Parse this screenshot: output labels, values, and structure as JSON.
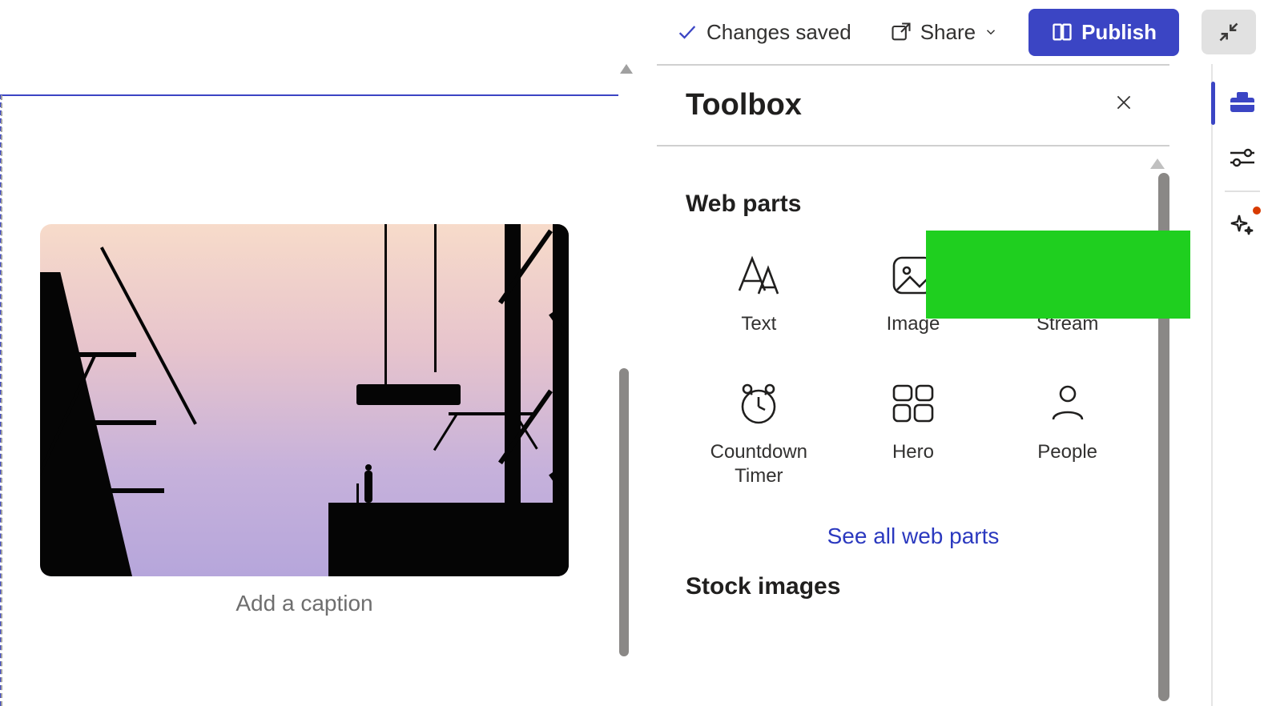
{
  "commandBar": {
    "savedStatus": "Changes saved",
    "shareLabel": "Share",
    "publishLabel": "Publish"
  },
  "canvas": {
    "captionPlaceholder": "Add a caption"
  },
  "toolbox": {
    "title": "Toolbox",
    "sections": {
      "webParts": {
        "title": "Web parts",
        "items": [
          {
            "label": "Text",
            "icon": "text-icon"
          },
          {
            "label": "Image",
            "icon": "image-icon"
          },
          {
            "label": "Stream",
            "icon": "stream-icon"
          },
          {
            "label": "Countdown Timer",
            "icon": "countdown-timer-icon"
          },
          {
            "label": "Hero",
            "icon": "hero-icon"
          },
          {
            "label": "People",
            "icon": "people-icon"
          }
        ],
        "seeAll": "See all web parts"
      },
      "stockImages": {
        "title": "Stock images"
      }
    }
  },
  "rightRail": {
    "items": [
      {
        "name": "toolbox-tab",
        "active": true
      },
      {
        "name": "settings-tab",
        "active": false
      },
      {
        "name": "ai-tab",
        "active": false,
        "hasBadge": true
      }
    ]
  }
}
